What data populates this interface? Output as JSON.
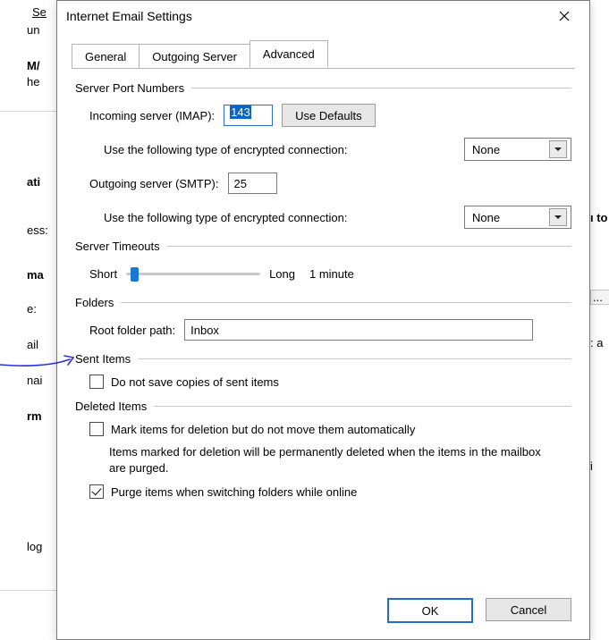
{
  "bg": {
    "l0": "Se",
    "l1": "un",
    "l2": "M/",
    "l3": "he",
    "l4": "ati",
    "l5": "ess:",
    "l6": "ma",
    "l7": "e:",
    "l8": "ail",
    "l9": "nai",
    "l10": "rm",
    "l11": "log",
    "r0": "ı to",
    "r1": "...",
    "r2": ": a",
    "r3": "i"
  },
  "dialog": {
    "title": "Internet Email Settings",
    "tabs": {
      "general": "General",
      "outgoing": "Outgoing Server",
      "advanced": "Advanced"
    },
    "server_ports": {
      "header": "Server Port Numbers",
      "incoming_label": "Incoming server (IMAP):",
      "incoming_value": "143",
      "use_defaults": "Use Defaults",
      "enc_label": "Use the following type of encrypted connection:",
      "enc_in_value": "None",
      "outgoing_label": "Outgoing server (SMTP):",
      "outgoing_value": "25",
      "enc_out_value": "None"
    },
    "timeouts": {
      "header": "Server Timeouts",
      "short": "Short",
      "long": "Long",
      "value": "1 minute",
      "pos_percent": 6
    },
    "folders": {
      "header": "Folders",
      "root_label": "Root folder path:",
      "root_value": "Inbox"
    },
    "sent": {
      "header": "Sent Items",
      "cb1": "Do not save copies of sent items",
      "cb1_checked": false
    },
    "deleted": {
      "header": "Deleted Items",
      "cb1": "Mark items for deletion but do not move them automatically",
      "cb1_checked": false,
      "note": "Items marked for deletion will be permanently deleted when the items in the mailbox are purged.",
      "cb2": "Purge items when switching folders while online",
      "cb2_checked": true
    },
    "footer": {
      "ok": "OK",
      "cancel": "Cancel"
    }
  }
}
